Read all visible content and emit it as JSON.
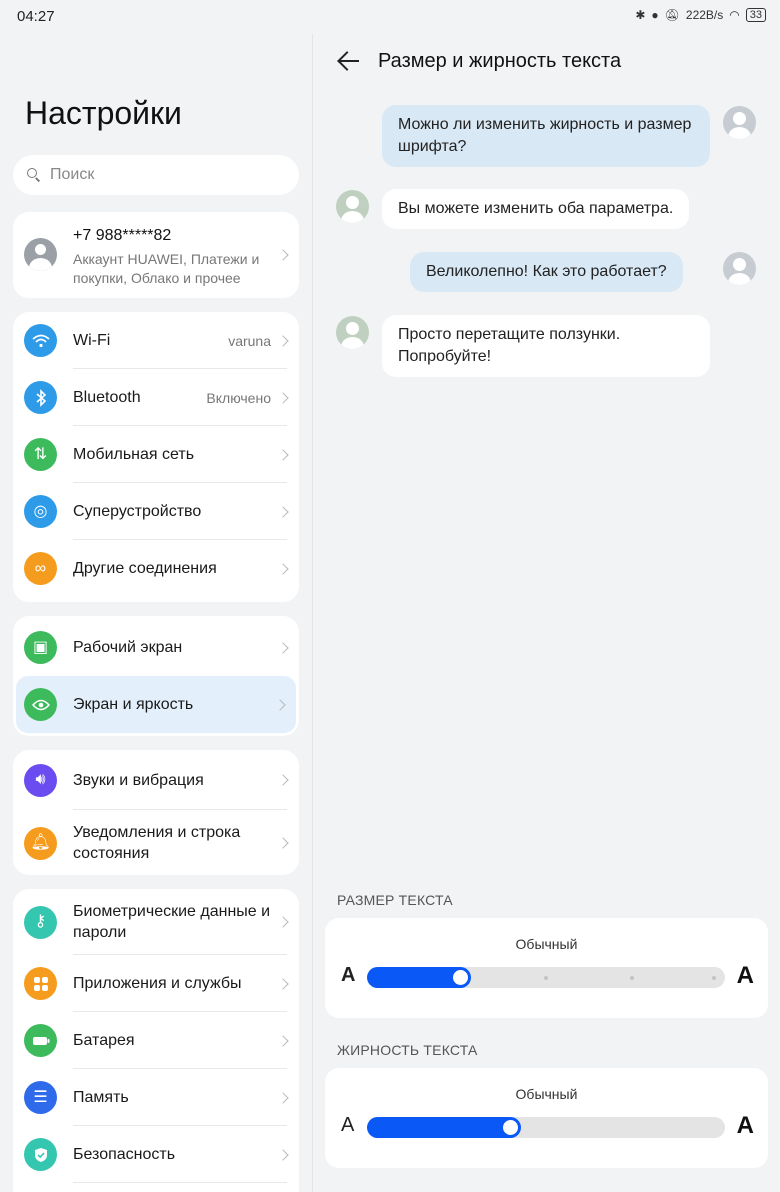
{
  "status_bar": {
    "time": "04:27",
    "speed": "222B/s",
    "battery": "33",
    "icons": [
      "bluetooth-icon",
      "location-icon",
      "mute-icon",
      "wifi-icon",
      "battery-icon"
    ]
  },
  "sidebar": {
    "title": "Настройки",
    "search_placeholder": "Поиск",
    "account": {
      "phone": "+7 988*****82",
      "subtitle": "Аккаунт HUAWEI, Платежи и покупки, Облако и прочее"
    },
    "groups": [
      [
        {
          "label": "Wi-Fi",
          "value": "varuna",
          "icon": "wifi-icon",
          "color": "#2e9be9"
        },
        {
          "label": "Bluetooth",
          "value": "Включено",
          "icon": "bluetooth-icon",
          "color": "#2e9be9"
        },
        {
          "label": "Мобильная сеть",
          "value": "",
          "icon": "mobile-network-icon",
          "color": "#3cba5c"
        },
        {
          "label": "Суперустройство",
          "value": "",
          "icon": "superdevice-icon",
          "color": "#2e9be9"
        },
        {
          "label": "Другие соединения",
          "value": "",
          "icon": "link-icon",
          "color": "#f59b1d"
        }
      ],
      [
        {
          "label": "Рабочий экран",
          "value": "",
          "icon": "home-screen-icon",
          "color": "#3cba5c"
        },
        {
          "label": "Экран и яркость",
          "value": "",
          "icon": "eye-icon",
          "color": "#3cba5c",
          "active": true
        }
      ],
      [
        {
          "label": "Звуки и вибрация",
          "value": "",
          "icon": "sound-icon",
          "color": "#6a4cf0"
        },
        {
          "label": "Уведомления и строка состояния",
          "value": "",
          "icon": "bell-icon",
          "color": "#f59b1d"
        }
      ],
      [
        {
          "label": "Биометрические данные и пароли",
          "value": "",
          "icon": "key-icon",
          "color": "#35c6b0"
        },
        {
          "label": "Приложения и службы",
          "value": "",
          "icon": "apps-icon",
          "color": "#f59b1d"
        },
        {
          "label": "Батарея",
          "value": "",
          "icon": "battery-icon",
          "color": "#3cba5c"
        },
        {
          "label": "Память",
          "value": "",
          "icon": "storage-icon",
          "color": "#2e6ae9"
        },
        {
          "label": "Безопасность",
          "value": "",
          "icon": "shield-icon",
          "color": "#35c6b0"
        }
      ]
    ]
  },
  "detail": {
    "title": "Размер и жирность текста",
    "chat": [
      {
        "from": "out",
        "text": "Можно ли изменить жирность и размер шрифта?"
      },
      {
        "from": "in",
        "text": "Вы можете изменить оба параметра."
      },
      {
        "from": "out",
        "text": "Великолепно! Как это работает?"
      },
      {
        "from": "in",
        "text": "Просто перетащите ползунки. Попробуйте!"
      }
    ],
    "size": {
      "label": "РАЗМЕР ТЕКСТА",
      "value_text": "Обычный",
      "small_a": "A",
      "big_a": "A",
      "level": 0.29
    },
    "weight": {
      "label": "ЖИРНОСТЬ ТЕКСТА",
      "value_text": "Обычный",
      "small_a": "A",
      "big_a": "A",
      "level": 0.43
    }
  }
}
